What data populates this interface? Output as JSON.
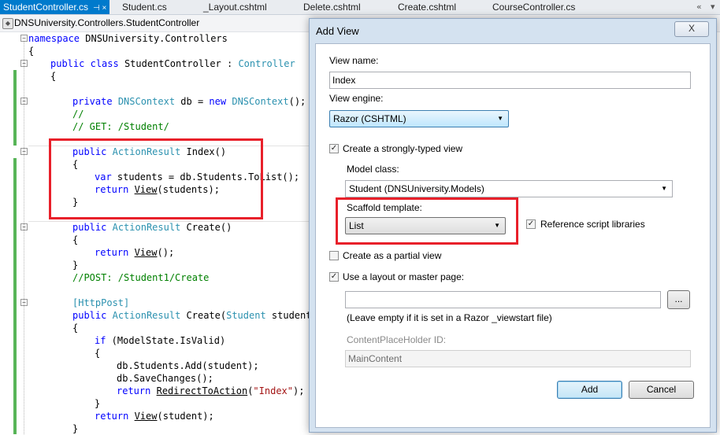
{
  "tabs": {
    "active": "StudentController.cs",
    "items": [
      "Student.cs",
      "_Layout.cshtml",
      "Delete.cshtml",
      "Create.cshtml",
      "CourseController.cs"
    ],
    "pin_glyph": "⊣ ×"
  },
  "navbar": {
    "scope": "DNSUniversity.Controllers.StudentController"
  },
  "code": {
    "namespace_kw": "namespace",
    "namespace_name": " DNSUniversity.Controllers",
    "open_brace": "{",
    "close_brace": "}",
    "class_line": {
      "kw1": "public",
      "kw2": "class",
      "name": " StudentController : ",
      "base": "Controller"
    },
    "db_line": {
      "kw": "private",
      "type1": "DNSContext",
      "mid": " db = ",
      "kw2": "new",
      "type2": "DNSContext",
      "end": "();"
    },
    "comment1": "//",
    "comment2": "// GET: /Student/",
    "index_sig": {
      "kw": "public",
      "type": "ActionResult",
      "rest": " Index()"
    },
    "index_body1": {
      "kw": "var",
      "rest": " students = db.Students.ToList();"
    },
    "index_body2": {
      "kw": "return",
      "call": "View",
      "rest": "(students);"
    },
    "create_sig": {
      "kw": "public",
      "type": "ActionResult",
      "rest": " Create()"
    },
    "create_body": {
      "kw": "return",
      "call": "View",
      "rest": "();"
    },
    "comment3": "//POST: /Student1/Create",
    "attr": "[HttpPost]",
    "create_post_sig": {
      "kw": "public",
      "type": "ActionResult",
      "rest1": " Create(",
      "ptype": "Student",
      "rest2": " student)"
    },
    "if_line": {
      "kw": "if",
      "rest": " (ModelState.IsValid)"
    },
    "add_line": "db.Students.Add(student);",
    "save_line": "db.SaveChanges();",
    "redirect_line": {
      "kw": "return",
      "call": "RedirectToAction",
      "open": "(",
      "str": "\"Index\"",
      "close": ");"
    },
    "return_view_student": {
      "kw": "return",
      "call": "View",
      "rest": "(student);"
    }
  },
  "dialog": {
    "title": "Add View",
    "close_label": "X",
    "view_name_label": "View name:",
    "view_name_value": "Index",
    "view_engine_label": "View engine:",
    "view_engine_value": "Razor (CSHTML)",
    "strongly_typed_label": "Create a strongly-typed view",
    "strongly_typed_checked": true,
    "model_class_label": "Model class:",
    "model_class_value": "Student (DNSUniversity.Models)",
    "scaffold_label": "Scaffold template:",
    "scaffold_value": "List",
    "reference_scripts_label": "Reference script libraries",
    "reference_scripts_checked": true,
    "partial_view_label": "Create as a partial view",
    "partial_view_checked": false,
    "use_layout_label": "Use a layout or master page:",
    "use_layout_checked": true,
    "layout_path_value": "",
    "browse_label": "...",
    "layout_hint": "(Leave empty if it is set in a Razor _viewstart file)",
    "placeholder_id_label": "ContentPlaceHolder ID:",
    "placeholder_id_value": "MainContent",
    "add_button": "Add",
    "cancel_button": "Cancel",
    "check_glyph": "✓"
  },
  "colors": {
    "highlight_box": "#e8202a",
    "active_tab": "#007acc",
    "change_bar": "#57b457"
  }
}
